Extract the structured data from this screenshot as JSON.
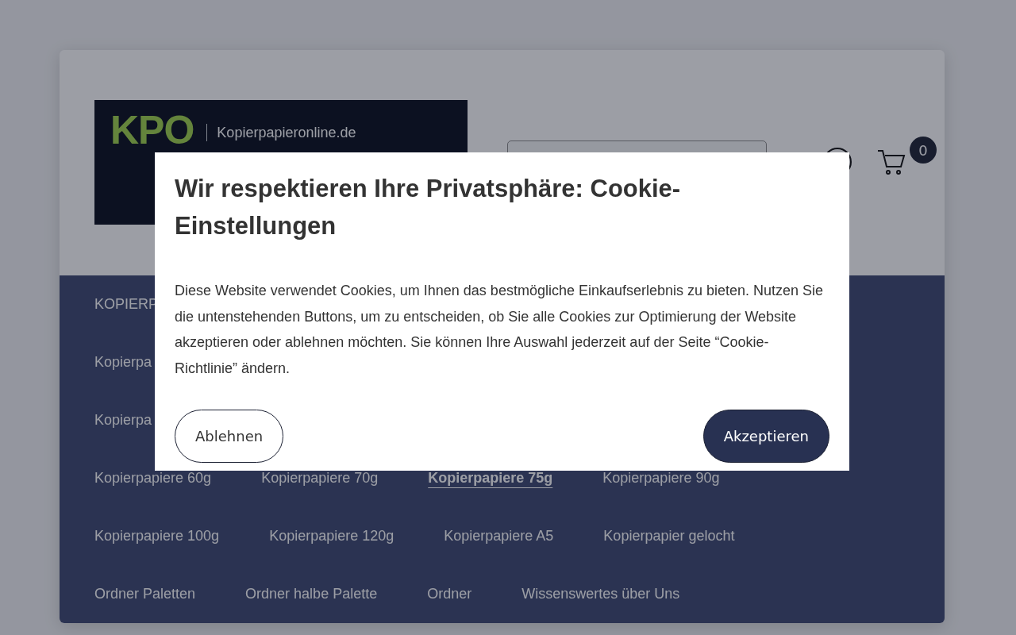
{
  "header": {
    "logo": {
      "mark": "KPO",
      "site": "Kopierpapieronline.de"
    },
    "cart": {
      "count": "0"
    }
  },
  "nav": {
    "items": [
      {
        "label": "KOPIERP",
        "selected": false
      },
      {
        "label": "Kopierpa",
        "selected": false
      },
      {
        "label": "Kopierpa",
        "selected": false
      },
      {
        "label": "Kopierpapiere 60g",
        "selected": false
      },
      {
        "label": "Kopierpapiere 70g",
        "selected": false
      },
      {
        "label": "Kopierpapiere 75g",
        "selected": true
      },
      {
        "label": "Kopierpapiere 90g",
        "selected": false
      },
      {
        "label": "Kopierpapiere 100g",
        "selected": false
      },
      {
        "label": "Kopierpapiere 120g",
        "selected": false
      },
      {
        "label": "Kopierpapiere A5",
        "selected": false
      },
      {
        "label": "Kopierpapier gelocht",
        "selected": false
      },
      {
        "label": "Ordner Paletten",
        "selected": false
      },
      {
        "label": "Ordner halbe Palette",
        "selected": false
      },
      {
        "label": "Ordner",
        "selected": false
      },
      {
        "label": "Wissenswertes über Uns",
        "selected": false
      }
    ]
  },
  "cookie_dialog": {
    "title": "Wir respektieren Ihre Privatsphäre: Cookie-Einstellungen",
    "text": "Diese Website verwendet Cookies, um Ihnen das bestmögliche Einkaufserlebnis zu bieten. Nutzen Sie die untenstehenden Buttons, um zu entscheiden, ob Sie alle Cookies zur Optimierung der Website akzeptieren oder ablehnen möchten. Sie können Ihre Auswahl jederzeit auf der Seite “Cookie-Richtlinie” ändern.",
    "buttons": [
      {
        "label": "Ablehnen",
        "kind": "secondary"
      },
      {
        "label": "Akzeptieren",
        "kind": "primary"
      }
    ]
  }
}
